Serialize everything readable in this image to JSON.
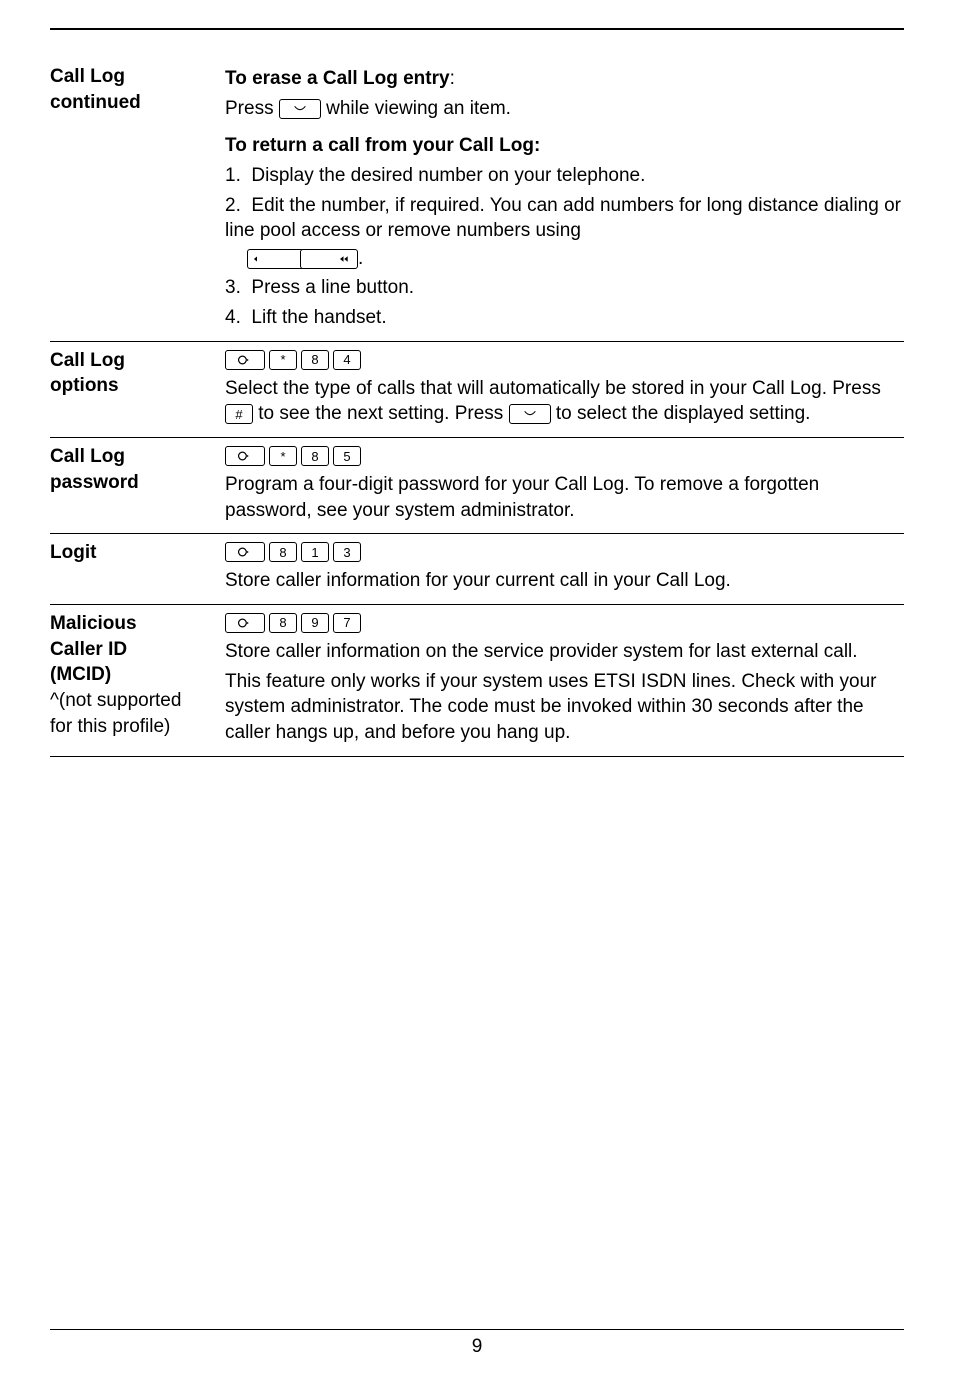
{
  "page_number": "9",
  "icons": {
    "feature": "feature-circle",
    "hold": "hold-smile",
    "star": "*",
    "hash": "#",
    "d1": "1",
    "d3": "3",
    "d4": "4",
    "d5": "5",
    "d7": "7",
    "d8": "8",
    "d9": "9",
    "vol_left": "◂",
    "vol_right": "◂◂"
  },
  "sections": [
    {
      "id": "call_log_continued",
      "label_lines": [
        "Call Log",
        "continued"
      ],
      "heading1": "To erase a Call Log entry",
      "heading1_suffix": ":",
      "text1_a": "Press",
      "text1_b": "while viewing an item.",
      "heading2": "To return a call from your Call Log:",
      "list": [
        "Display the desired number on your telephone.",
        "Edit the number, if required. You can add numbers for long distance dialing or line pool access or remove numbers using",
        "Press a line button.",
        "Lift the handset."
      ],
      "list_item2_trailing_period": "."
    },
    {
      "id": "call_log_options",
      "label_lines": [
        "Call Log",
        "options"
      ],
      "keys": [
        "feature",
        "*",
        "8",
        "4"
      ],
      "text_a": "Select the type of calls that will automatically be stored in your Call Log. Press",
      "text_b": "to see the next setting. Press",
      "text_c": "to select the displayed setting."
    },
    {
      "id": "call_log_password",
      "label_lines": [
        "Call Log",
        "password"
      ],
      "keys": [
        "feature",
        "*",
        "8",
        "5"
      ],
      "text": "Program a four-digit password for your Call Log. To remove a forgotten password, see your system administrator."
    },
    {
      "id": "logit",
      "label_lines": [
        "Logit"
      ],
      "keys": [
        "feature",
        "8",
        "1",
        "3"
      ],
      "text": "Store caller information for your current call in your Call Log."
    },
    {
      "id": "mcid",
      "label_lines": [
        "Malicious",
        "Caller ID",
        "(MCID)"
      ],
      "label_note_lines": [
        "^(not supported",
        "for this profile)"
      ],
      "keys": [
        "feature",
        "8",
        "9",
        "7"
      ],
      "text1": "Store caller information on the service provider system for last external call.",
      "text2": "This feature only works if your system uses ETSI ISDN lines. Check with your system administrator. The code must be invoked within 30 seconds after the caller hangs up, and before you hang up."
    }
  ]
}
